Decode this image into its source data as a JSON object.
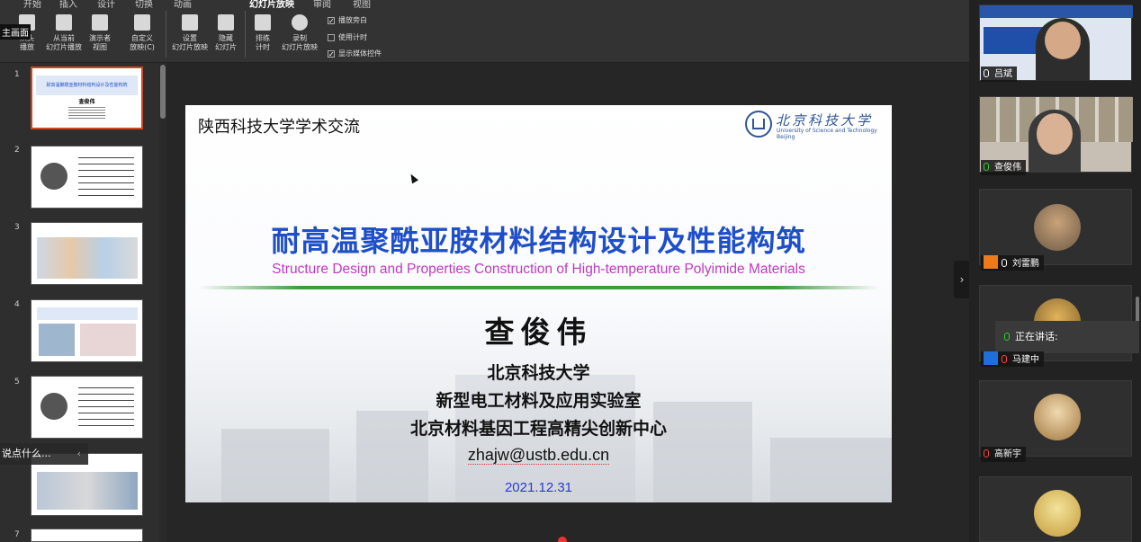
{
  "ribbon": {
    "tabs": [
      "开始",
      "插入",
      "设计",
      "切换",
      "动画",
      "幻灯片放映",
      "审阅",
      "视图"
    ],
    "buttons": [
      {
        "label1": "从头",
        "label2": "播放"
      },
      {
        "label1": "从当前",
        "label2": "幻灯片播放"
      },
      {
        "label1": "演示者",
        "label2": "视图"
      },
      {
        "label1": "自定义",
        "label2": "放映(C)"
      },
      {
        "label1": "设置",
        "label2": "幻灯片放映"
      },
      {
        "label1": "隐藏",
        "label2": "幻灯片"
      },
      {
        "label1": "排练",
        "label2": "计时"
      },
      {
        "label1": "录制",
        "label2": "幻灯片放映"
      }
    ],
    "checkboxes": [
      {
        "label": "播放旁白",
        "checked": "✓"
      },
      {
        "label": "使用计时",
        "checked": ""
      },
      {
        "label": "显示媒体控件",
        "checked": "✓"
      }
    ],
    "main_screen_label": "主画面"
  },
  "thumbnails": {
    "numbers": [
      "1",
      "2",
      "3",
      "4",
      "5",
      "6",
      "7"
    ],
    "slide1_title": "耐高温聚酰亚胺材料结构设计及性能构筑",
    "slide1_name": "查俊伟"
  },
  "chat_placeholder": "说点什么...",
  "slide": {
    "header": "陕西科技大学学术交流",
    "logo_cn": "北京科技大学",
    "logo_en": "University of Science and Technology Beijing",
    "title_cn": "耐高温聚酰亚胺材料结构设计及性能构筑",
    "title_en": "Structure Design and Properties Construction of High-temperature Polyimide Materials",
    "author": "查俊伟",
    "affil1": "北京科技大学",
    "affil2": "新型电工材料及应用实验室",
    "affil3": "北京材料基因工程高精尖创新中心",
    "email": "zhajw@ustb.edu.cn",
    "date": "2021.12.31"
  },
  "participants": [
    {
      "name": "吕斌"
    },
    {
      "name": "查俊伟"
    },
    {
      "name": "刘雷鹏"
    },
    {
      "name": "马建中"
    },
    {
      "name": "高新宇"
    }
  ],
  "speaking_label": "正在讲话:",
  "colors": {
    "accent": "#d24726",
    "title_blue": "#1f4fc8",
    "subtitle_purple": "#c13ac2",
    "date_blue": "#2a3ad1"
  }
}
